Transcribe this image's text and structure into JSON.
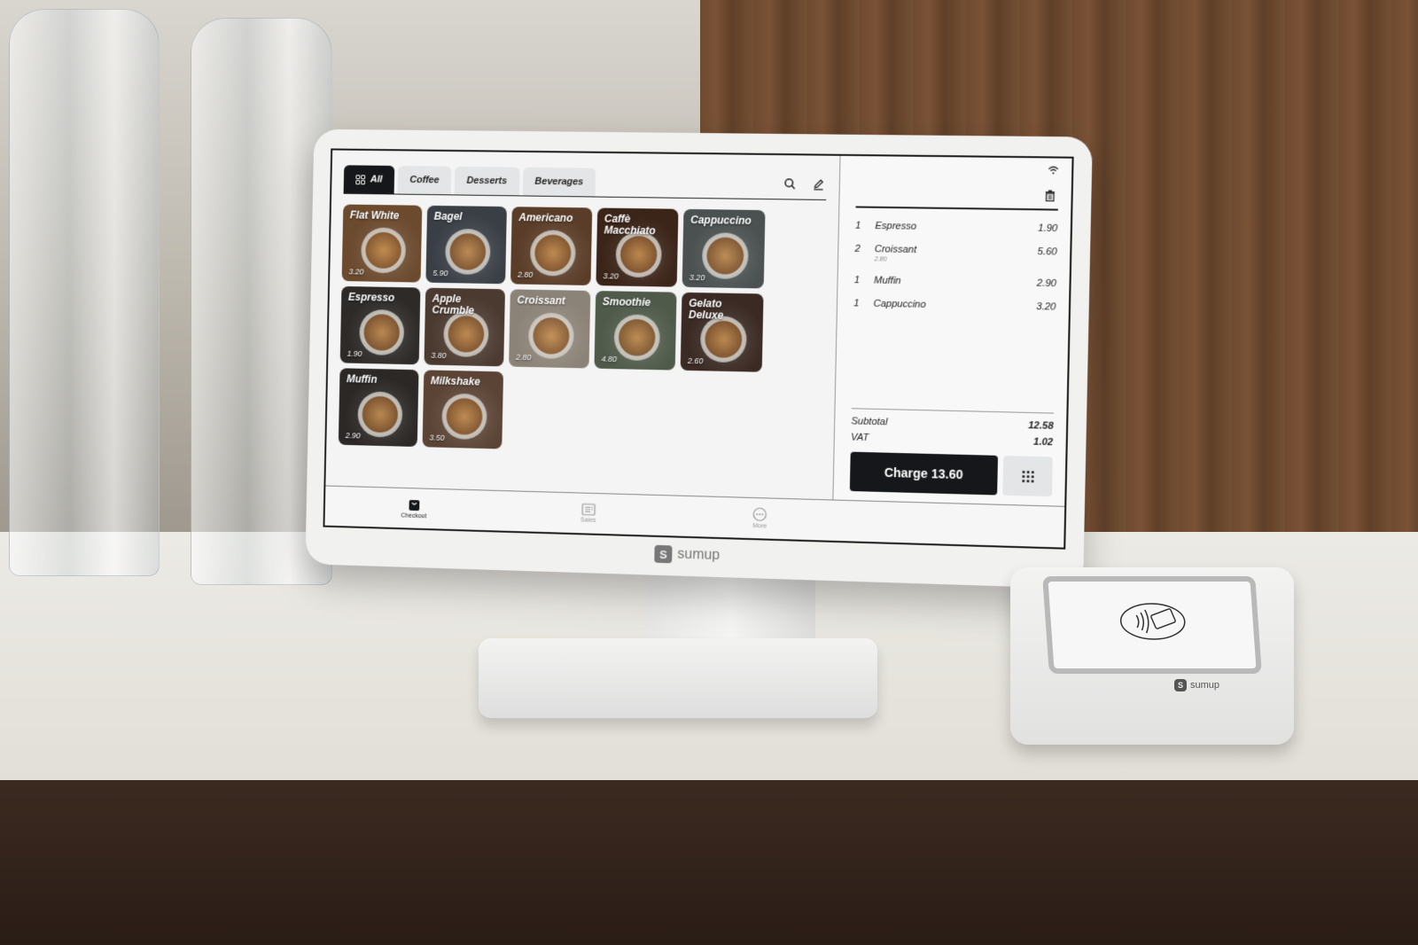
{
  "app": {
    "brand": "sumup",
    "tabs": [
      {
        "label": "All",
        "active": true,
        "icon": "grid-icon"
      },
      {
        "label": "Coffee",
        "active": false
      },
      {
        "label": "Desserts",
        "active": false
      },
      {
        "label": "Beverages",
        "active": false
      }
    ],
    "tools": {
      "search_icon": "search-icon",
      "edit_icon": "pencil-icon"
    },
    "products": [
      {
        "name": "Flat White",
        "price": "3.20",
        "color": "#6b4a2e"
      },
      {
        "name": "Bagel",
        "price": "5.90",
        "color": "#3a3f45"
      },
      {
        "name": "Americano",
        "price": "2.80",
        "color": "#5a3d28"
      },
      {
        "name": "Caffè Macchiato",
        "price": "3.20",
        "color": "#3b2418"
      },
      {
        "name": "Cappuccino",
        "price": "3.20",
        "color": "#4a5150"
      },
      {
        "name": "Espresso",
        "price": "1.90",
        "color": "#2d2a28"
      },
      {
        "name": "Apple Crumble",
        "price": "3.80",
        "color": "#4b3a30"
      },
      {
        "name": "Croissant",
        "price": "2.80",
        "color": "#8c8378"
      },
      {
        "name": "Smoothie",
        "price": "4.80",
        "color": "#4f5a4a"
      },
      {
        "name": "Gelato Deluxe",
        "price": "2.60",
        "color": "#3b2a24"
      },
      {
        "name": "Muffin",
        "price": "2.90",
        "color": "#2b2826"
      },
      {
        "name": "Milkshake",
        "price": "3.50",
        "color": "#5b4436"
      }
    ],
    "cart": {
      "items": [
        {
          "qty": "1",
          "name": "Espresso",
          "unit_price": "",
          "amount": "1.90"
        },
        {
          "qty": "2",
          "name": "Croissant",
          "unit_price": "2.80",
          "amount": "5.60"
        },
        {
          "qty": "1",
          "name": "Muffin",
          "unit_price": "",
          "amount": "2.90"
        },
        {
          "qty": "1",
          "name": "Cappuccino",
          "unit_price": "",
          "amount": "3.20"
        }
      ],
      "subtotal_label": "Subtotal",
      "subtotal": "12.58",
      "vat_label": "VAT",
      "vat": "1.02",
      "charge_label": "Charge 13.60"
    },
    "nav": [
      {
        "label": "Checkout",
        "icon": "bag-icon",
        "active": true
      },
      {
        "label": "Sales",
        "icon": "receipt-icon",
        "active": false
      },
      {
        "label": "More",
        "icon": "more-icon",
        "active": false
      }
    ]
  },
  "reader": {
    "brand": "sumup"
  }
}
